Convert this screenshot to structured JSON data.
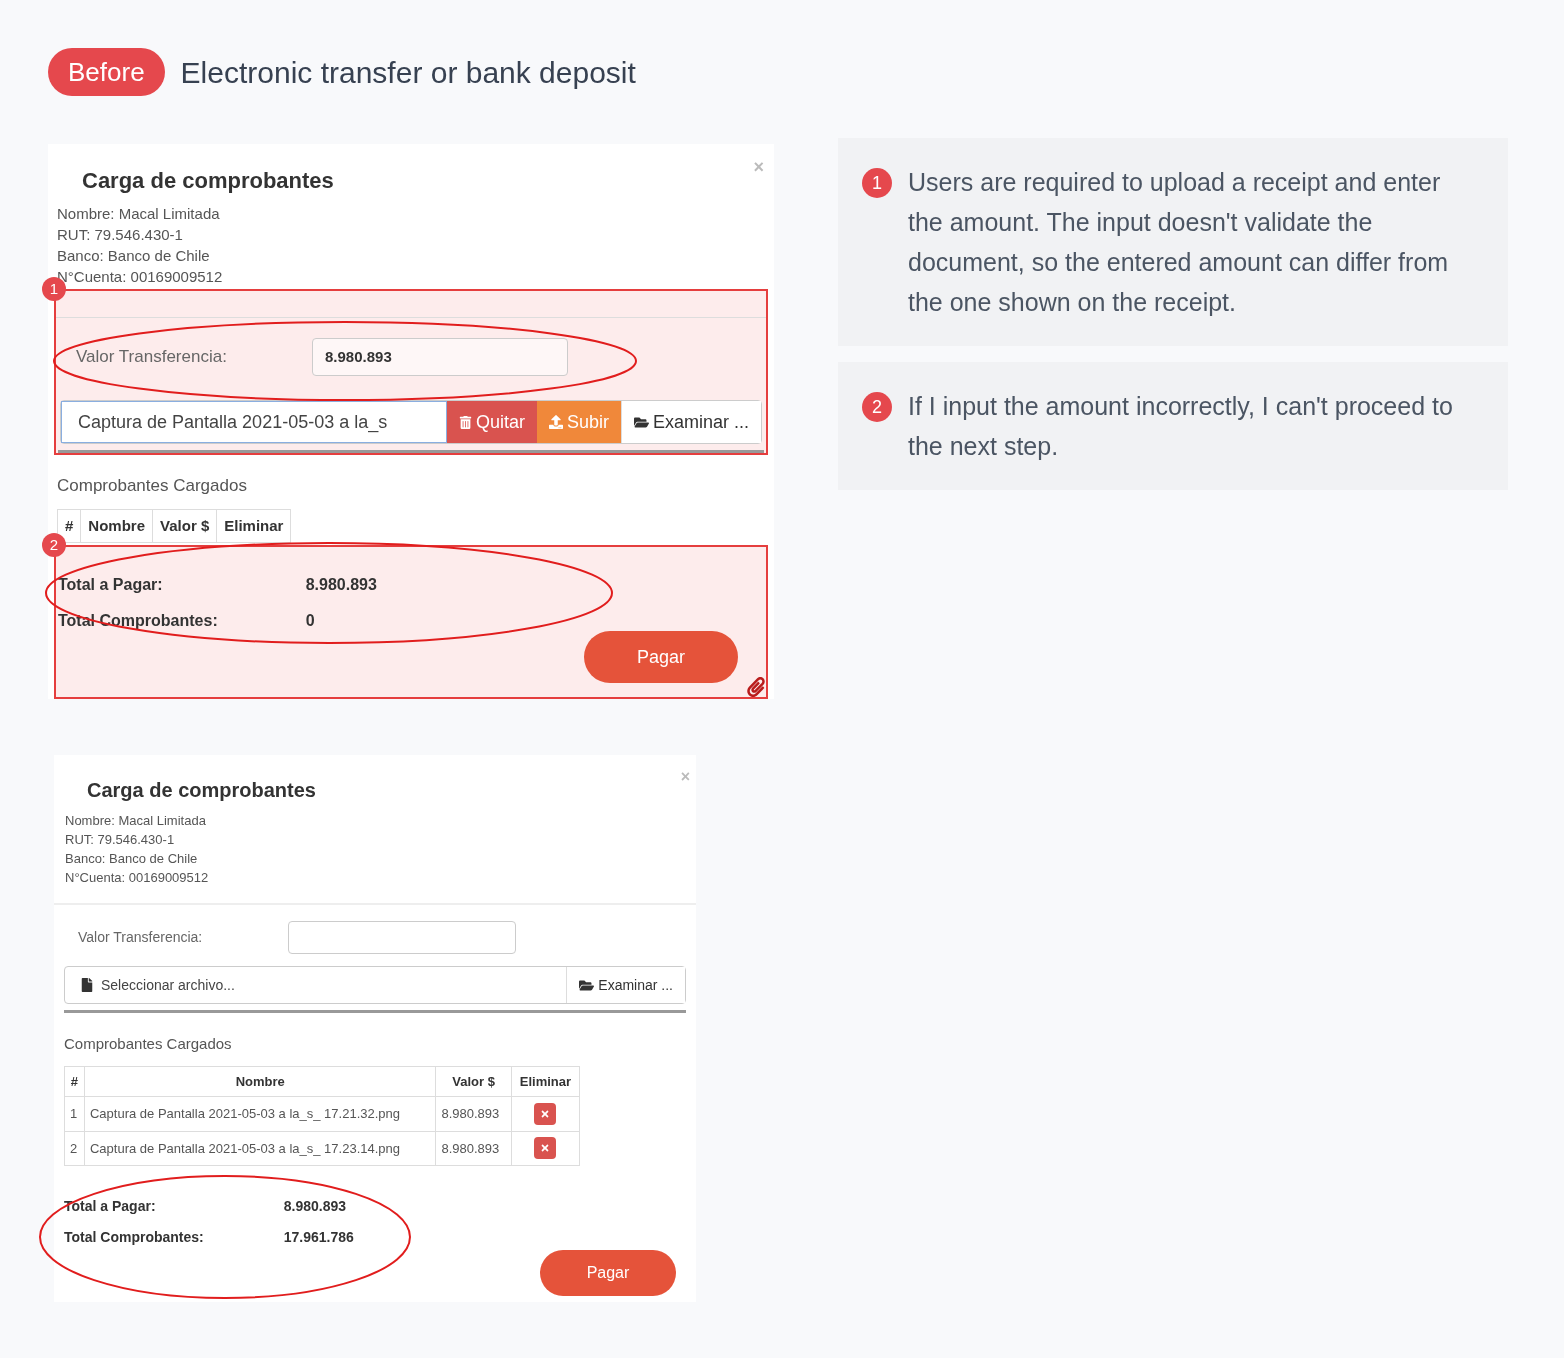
{
  "header": {
    "badge": "Before",
    "title": "Electronic transfer or bank deposit"
  },
  "screens": [
    {
      "title": "Carga de comprobantes",
      "close": "×",
      "info": [
        "Nombre: Macal Limitada",
        "RUT: 79.546.430-1",
        "Banco: Banco de Chile",
        "N°Cuenta: 00169009512"
      ],
      "amount": {
        "label": "Valor Transferencia:",
        "value": "8.980.893",
        "circled": true
      },
      "file": {
        "value": "Captura de Pantalla 2021-05-03 a la_s",
        "buttons": [
          {
            "kind": "remove",
            "label": "Quitar"
          },
          {
            "kind": "upload",
            "label": "Subir"
          },
          {
            "kind": "browse",
            "label": "Examinar ..."
          }
        ]
      },
      "highlight_1": "1",
      "section_title": "Comprobantes Cargados",
      "columns": [
        "#",
        "Nombre",
        "Valor $",
        "Eliminar"
      ],
      "totals": [
        {
          "label": "Total a Pagar:",
          "value": "8.980.893"
        },
        {
          "label": "Total Comprobantes:",
          "value": "0"
        }
      ],
      "totals_circled": true,
      "highlight_2": "2",
      "pay": "Pagar"
    },
    {
      "title": "Carga de comprobantes",
      "close": "×",
      "info": [
        "Nombre: Macal Limitada",
        "RUT: 79.546.430-1",
        "Banco: Banco de Chile",
        "N°Cuenta: 00169009512"
      ],
      "amount": {
        "label": "Valor Transferencia:"
      },
      "file": {
        "placeholder": "Seleccionar archivo...",
        "buttons": [
          {
            "kind": "browse",
            "label": "Examinar ..."
          }
        ]
      },
      "section_title": "Comprobantes Cargados",
      "columns": [
        "#",
        "Nombre",
        "Valor $",
        "Eliminar"
      ],
      "rows": [
        {
          "index": "1",
          "name": "Captura de Pantalla 2021-05-03 a la_s_ 17.21.32.png",
          "value": "8.980.893"
        },
        {
          "index": "2",
          "name": "Captura de Pantalla 2021-05-03 a la_s_ 17.23.14.png",
          "value": "8.980.893"
        }
      ],
      "totals": [
        {
          "label": "Total a Pagar:",
          "value": "8.980.893"
        },
        {
          "label": "Total Comprobantes:",
          "value": "17.961.786"
        }
      ],
      "totals_circled": true,
      "pay": "Pagar"
    }
  ],
  "notes": [
    {
      "number": "1",
      "text": "Users are required to upload a receipt and enter the amount. The input doesn't validate the document, so the entered amount can differ from the one shown on the receipt."
    },
    {
      "number": "2",
      "text": "If I input the amount incorrectly, I can't proceed to the next step."
    }
  ]
}
